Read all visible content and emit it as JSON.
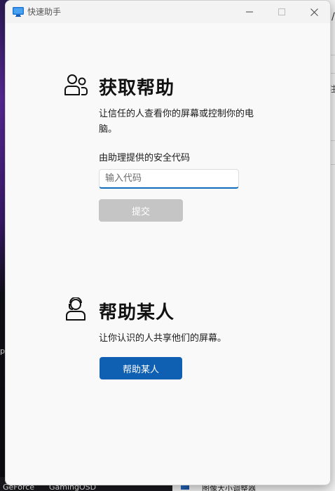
{
  "window": {
    "title": "快速助手"
  },
  "get_help": {
    "heading": "获取帮助",
    "description_line1": "让信任的人查看你的屏幕或控制你的电",
    "description_line2": "脑。",
    "code_label": "由助理提供的安全代码",
    "code_input": {
      "value": "",
      "placeholder": "输入代码"
    },
    "submit_label": "提交"
  },
  "help_someone": {
    "heading": "帮助某人",
    "description": "让你认识的人共享他们的屏幕。",
    "button_label": "帮助某人"
  },
  "background": {
    "right_fragment_top": "/p",
    "right_fragment_mid": "注",
    "left_fragment": "p",
    "taskbar_item_1": "GeForce",
    "taskbar_item_2": "GamingOSD",
    "taskbar_item_3": "图像大小调整器"
  },
  "colors": {
    "accent": "#0f5fb3",
    "input_focus": "#0f6cbd",
    "disabled_button": "#c5c5c5",
    "window_bg": "#f9f9f9"
  },
  "icons": {
    "app": "quick-assist-icon",
    "get_help": "people-icon",
    "help_someone": "person-headset-icon"
  }
}
